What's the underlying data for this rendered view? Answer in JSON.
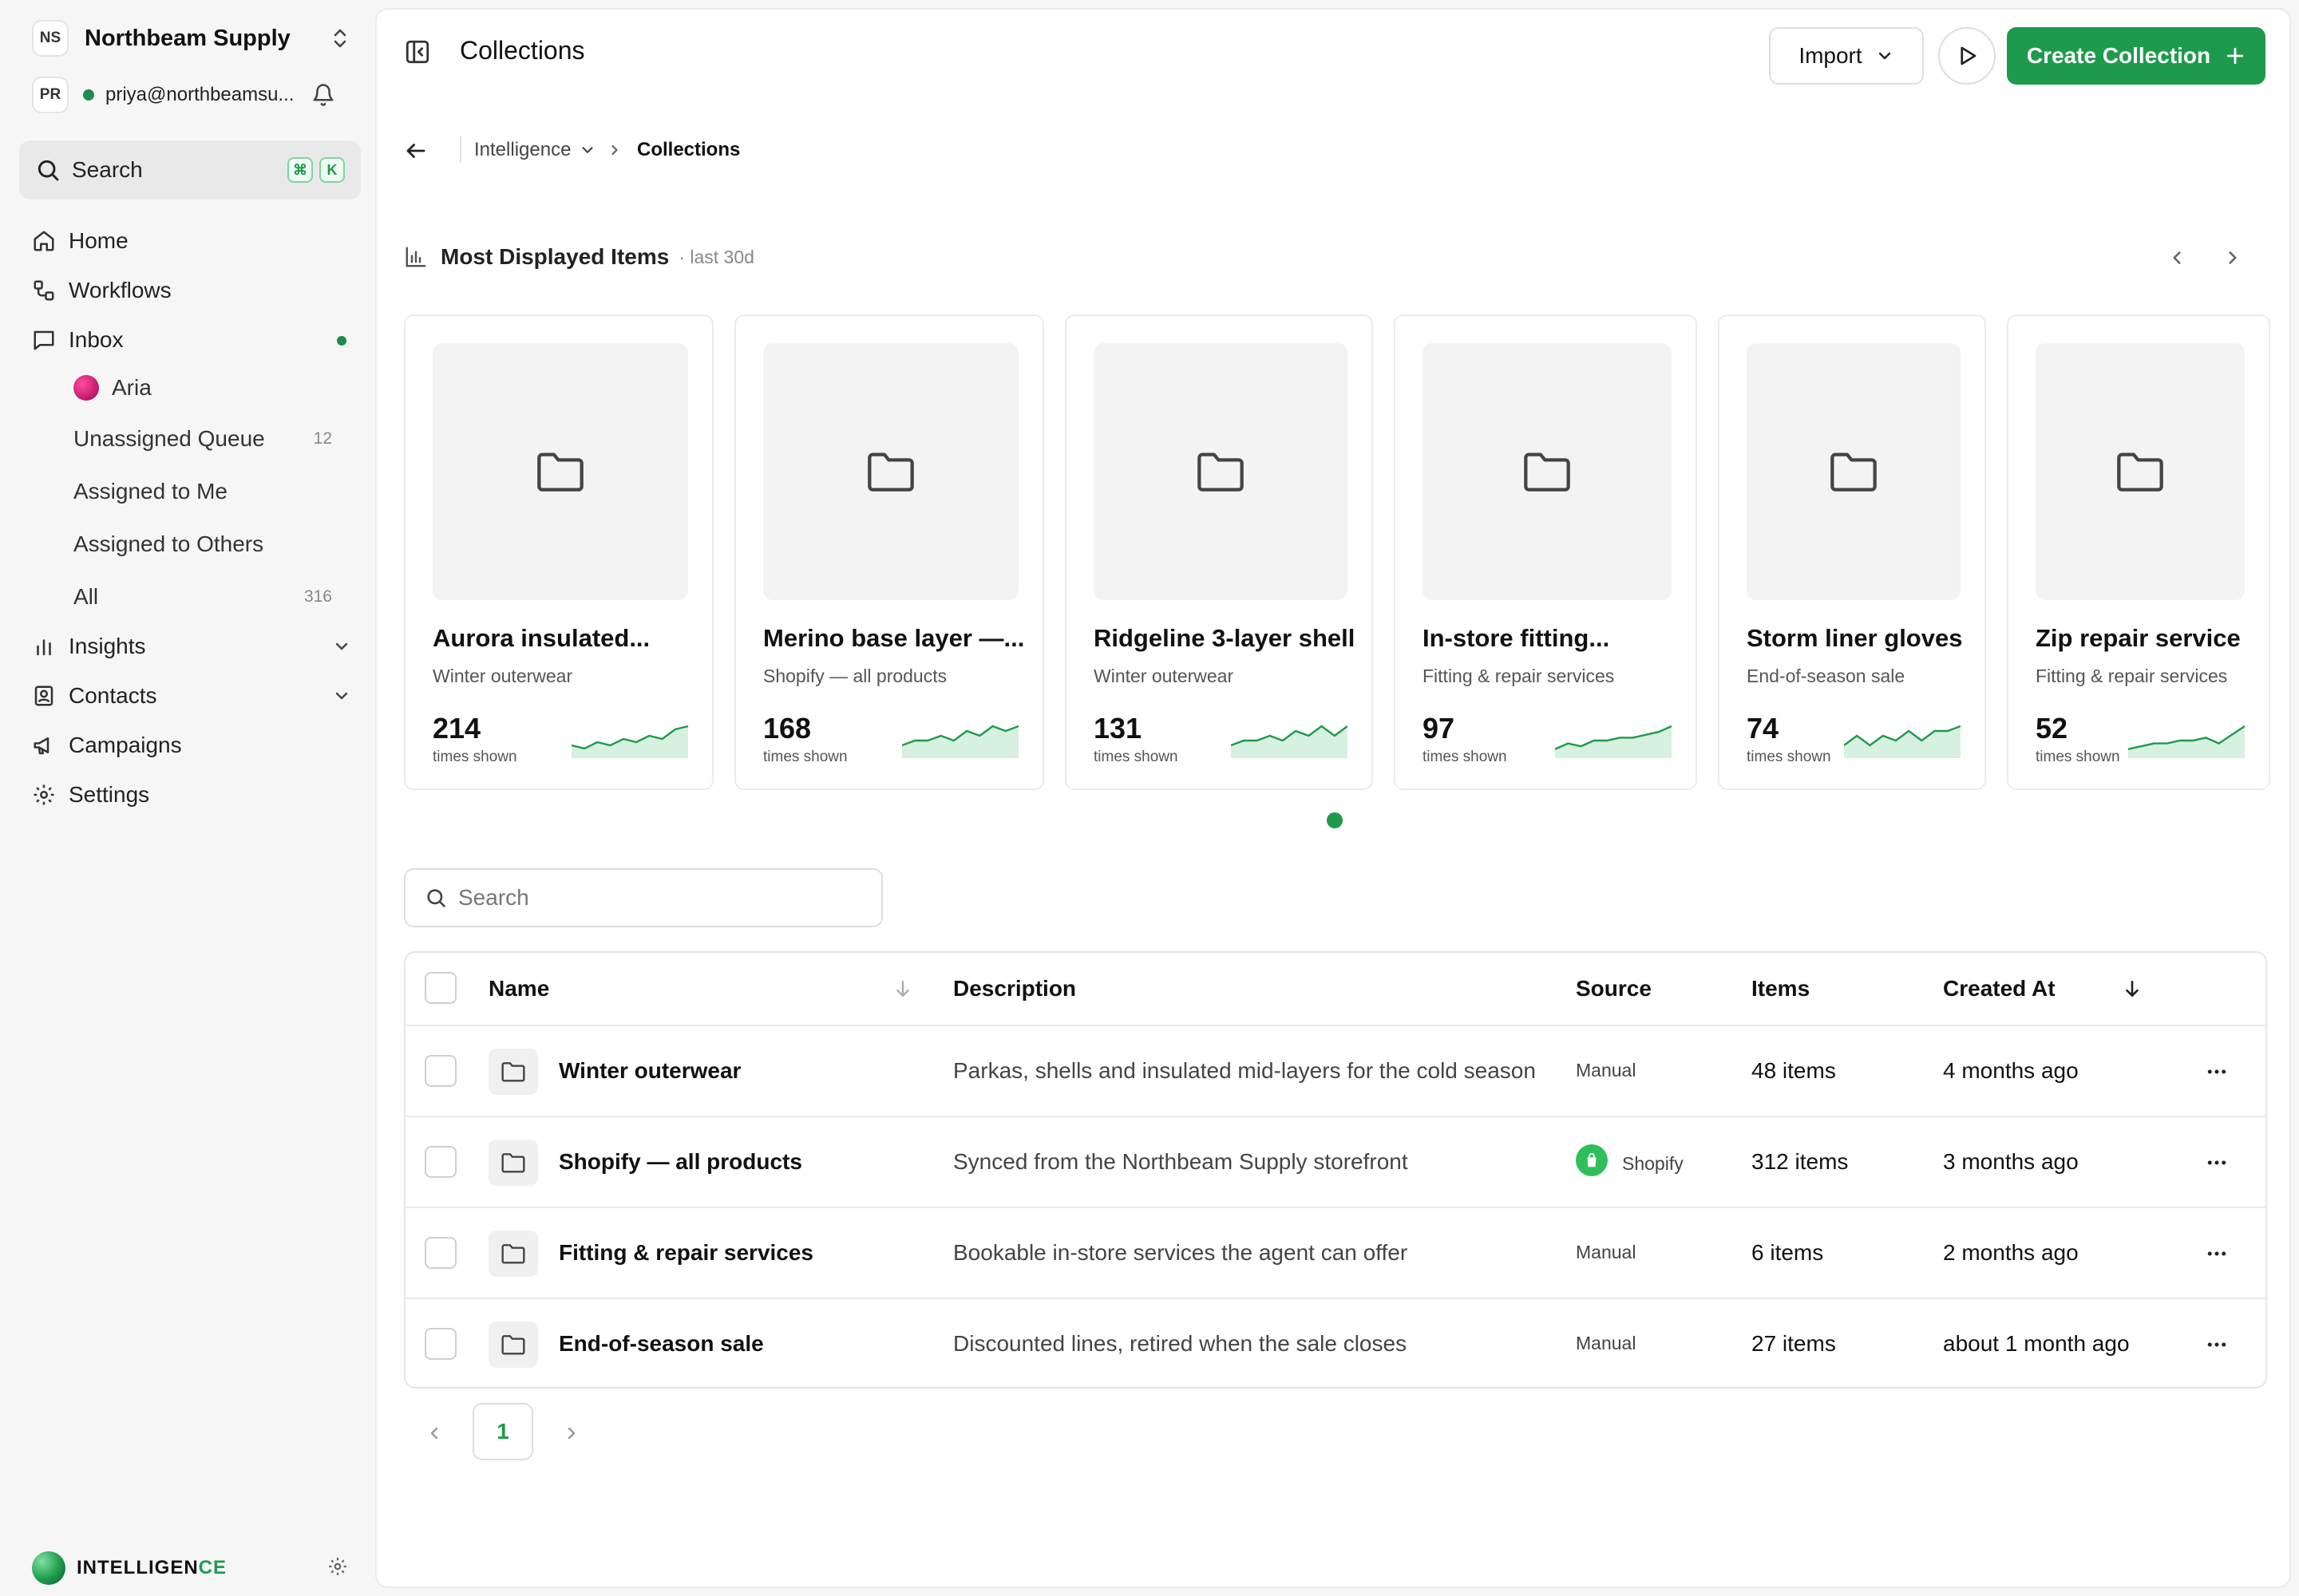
{
  "workspace": {
    "initials": "NS",
    "name": "Northbeam Supply"
  },
  "user": {
    "initials": "PR",
    "email": "priya@northbeamsu..."
  },
  "sidebar": {
    "search_label": "Search",
    "shortcut": [
      "⌘",
      "K"
    ],
    "nav": {
      "home": "Home",
      "workflows": "Workflows",
      "inbox": "Inbox",
      "aria": "Aria",
      "unassigned": {
        "label": "Unassigned Queue",
        "count": "12"
      },
      "assigned_me": "Assigned to Me",
      "assigned_others": "Assigned to Others",
      "all": {
        "label": "All",
        "count": "316"
      },
      "insights": "Insights",
      "contacts": "Contacts",
      "campaigns": "Campaigns",
      "settings": "Settings"
    },
    "brand": {
      "prefix": "INTELLIGEN",
      "accent": "CE"
    }
  },
  "header": {
    "title": "Collections",
    "import_label": "Import",
    "create_label": "Create Collection"
  },
  "breadcrumb": {
    "parent": "Intelligence",
    "current": "Collections"
  },
  "most_displayed": {
    "title": "Most Displayed Items",
    "period": "· last 30d",
    "unit_label": "times shown",
    "cards": [
      {
        "title": "Aurora insulated...",
        "collection": "Winter outerwear",
        "value": "214",
        "trend": [
          4,
          3,
          5,
          4,
          6,
          5,
          7,
          6,
          9,
          10
        ]
      },
      {
        "title": "Merino base layer —...",
        "collection": "Shopify — all products",
        "value": "168",
        "trend": [
          4,
          5,
          5,
          6,
          5,
          7,
          6,
          8,
          7,
          8
        ]
      },
      {
        "title": "Ridgeline 3-layer shell",
        "collection": "Winter outerwear",
        "value": "131",
        "trend": [
          3,
          4,
          4,
          5,
          4,
          6,
          5,
          7,
          5,
          7
        ]
      },
      {
        "title": "In-store fitting...",
        "collection": "Fitting & repair services",
        "value": "97",
        "trend": [
          2,
          4,
          3,
          5,
          5,
          6,
          6,
          7,
          8,
          10
        ]
      },
      {
        "title": "Storm liner gloves",
        "collection": "End-of-season sale",
        "value": "74",
        "trend": [
          3,
          5,
          3,
          5,
          4,
          6,
          4,
          6,
          6,
          7
        ]
      },
      {
        "title": "Zip repair service",
        "collection": "Fitting & repair services",
        "value": "52",
        "trend": [
          2,
          3,
          4,
          4,
          5,
          5,
          6,
          4,
          7,
          10
        ]
      }
    ]
  },
  "table": {
    "search_placeholder": "Search",
    "columns": {
      "name": "Name",
      "description": "Description",
      "source": "Source",
      "items": "Items",
      "created": "Created At"
    },
    "rows": [
      {
        "name": "Winter outerwear",
        "description": "Parkas, shells and insulated mid-layers for the cold season",
        "source": "Manual",
        "items": "48 items",
        "created": "4 months ago"
      },
      {
        "name": "Shopify — all products",
        "description": "Synced from the Northbeam Supply storefront",
        "source": "Shopify",
        "items": "312 items",
        "created": "3 months ago"
      },
      {
        "name": "Fitting & repair services",
        "description": "Bookable in-store services the agent can offer",
        "source": "Manual",
        "items": "6 items",
        "created": "2 months ago"
      },
      {
        "name": "End-of-season sale",
        "description": "Discounted lines, retired when the sale closes",
        "source": "Manual",
        "items": "27 items",
        "created": "about 1 month ago"
      }
    ]
  },
  "pagination": {
    "current": "1"
  },
  "colors": {
    "accent": "#1e9a4c",
    "spark_fill": "#d6f1df",
    "spark_line": "#1e9a4c"
  }
}
